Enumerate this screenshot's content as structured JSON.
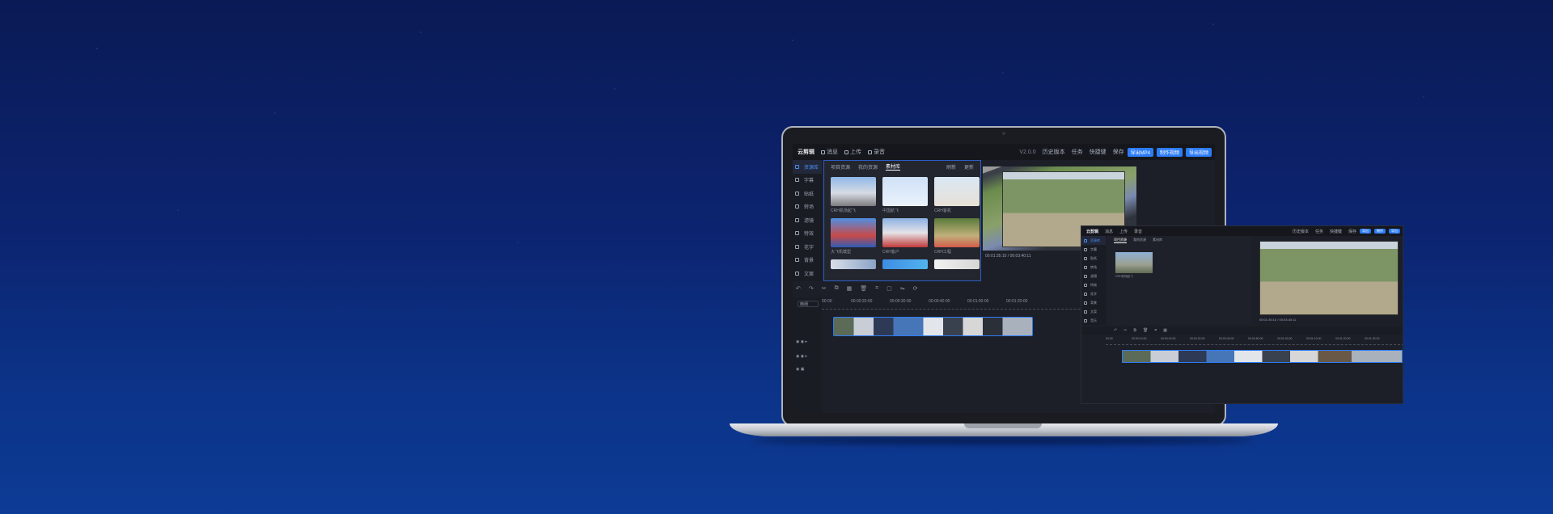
{
  "laptop_app": {
    "title": "云剪辑",
    "toolbar": [
      "消息",
      "上传",
      "录音"
    ],
    "version": "V2.0.0",
    "right_items": [
      "历史版本",
      "任务",
      "快捷键",
      "保存"
    ],
    "buttons": [
      "导出MP4",
      "制作视频",
      "导出视频"
    ],
    "sidebar": [
      "资源库",
      "字幕",
      "贴纸",
      "转场",
      "滤镜",
      "特效",
      "花字",
      "背景",
      "文案",
      "音乐"
    ],
    "tabs": [
      "项目资源",
      "我的资源",
      "素材库"
    ],
    "tab_right": [
      "刷新",
      "更新"
    ],
    "thumbs": [
      {
        "cap": "CRH机场起飞"
      },
      {
        "cap": "中国航飞"
      },
      {
        "cap": "CRH客机"
      },
      {
        "cap": "大飞机模型"
      },
      {
        "cap": "CRH客户"
      },
      {
        "cap": "CRH工程"
      },
      {
        "cap": ""
      },
      {
        "cap": ""
      },
      {
        "cap": ""
      }
    ],
    "timecode": "00:01:35:10 / 00:03:40:11",
    "zoom": "精细",
    "ruler": [
      "00:00",
      "00:00:20:00",
      "00:00:30:00",
      "00:00:40:00",
      "00:01:00:00",
      "00:01:20:00"
    ]
  },
  "small_app": {
    "title": "云剪辑",
    "toolbar": [
      "消息",
      "上传",
      "录音"
    ],
    "right_items": [
      "历史版本",
      "任务",
      "快捷键",
      "保存"
    ],
    "buttons": [
      "导出",
      "制作",
      "导出"
    ],
    "sidebar": [
      "资源库",
      "字幕",
      "贴纸",
      "转场",
      "滤镜",
      "特效",
      "花字",
      "背景",
      "文案",
      "音乐"
    ],
    "tabs": [
      "项目资源",
      "我的资源",
      "素材库"
    ],
    "thumb_cap": "CRH机场起飞",
    "timecode": "00:01:35:10 / 00:03:40:11",
    "ruler": [
      "00:00",
      "00:00:10:00",
      "00:00:20:00",
      "00:00:30:00",
      "00:00:40:00",
      "00:00:50:00",
      "00:01:00:00",
      "00:01:10:00",
      "00:01:20:00",
      "00:01:30:00"
    ]
  },
  "icons": [
    "undo-icon",
    "redo-icon",
    "cut-icon",
    "copy-icon",
    "delete-icon",
    "crop-icon",
    "split-icon"
  ]
}
